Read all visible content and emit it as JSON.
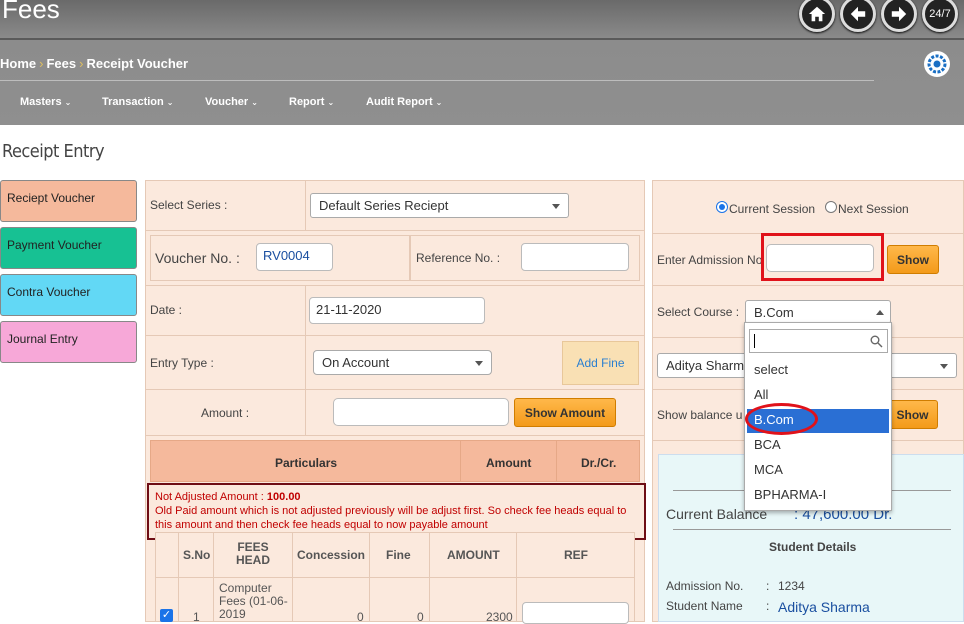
{
  "header": {
    "title": "Fees",
    "icons": [
      "home-icon",
      "arrow-left-icon",
      "arrow-right-icon",
      "support-24-7-icon"
    ],
    "support_label": "24/7",
    "breadcrumb": [
      "Home",
      "Fees",
      "Receipt Voucher"
    ]
  },
  "menu": [
    "Masters",
    "Transaction",
    "Voucher",
    "Report",
    "Audit Report"
  ],
  "page_title": "Receipt Entry",
  "nav": [
    {
      "label": "Reciept Voucher",
      "color": "#f5b99c"
    },
    {
      "label": "Payment Voucher",
      "color": "#17c193"
    },
    {
      "label": "Contra Voucher",
      "color": "#62d8f5"
    },
    {
      "label": "Journal Entry",
      "color": "#f7a8d8"
    }
  ],
  "form": {
    "select_series_label": "Select Series :",
    "select_series_value": "Default Series Reciept",
    "voucher_no_label": "Voucher No. :",
    "voucher_no_value": "RV0004",
    "reference_no_label": "Reference No. :",
    "reference_no_value": "",
    "date_label": "Date :",
    "date_value": "21-11-2020",
    "entry_type_label": "Entry Type :",
    "entry_type_value": "On Account",
    "add_fine_label": "Add Fine",
    "amount_label": "Amount :",
    "amount_value": "",
    "show_amount_label": "Show Amount"
  },
  "table": {
    "header": [
      "Particulars",
      "Amount",
      "Dr./Cr."
    ],
    "notice_title": "Not Adjusted Amount : ",
    "notice_amount": "100.00",
    "notice_text": "Old Paid amount which is not adjusted previously will be adjust first. So check fee heads equal to this amount and then check fee heads equal to now payable amount",
    "columns": [
      "S.No",
      "FEES HEAD",
      "Concession",
      "Fine",
      "AMOUNT",
      "REF"
    ],
    "rows": [
      {
        "checked": true,
        "sno": "1",
        "head": "Computer Fees (01-06-2019",
        "concession": "0",
        "fine": "0",
        "amount": "2300",
        "ref": ""
      }
    ]
  },
  "right": {
    "current_session_label": "Current Session",
    "next_session_label": "Next Session",
    "admission_label": "Enter Admission No",
    "admission_value": "",
    "show_label": "Show",
    "select_course_label": "Select Course :",
    "select_course_value": "B.Com",
    "student_select_value": "Aditya Sharm",
    "show_balance_label": "Show balance u",
    "show2_label": "Show",
    "current_balance_label": "Current Balance",
    "current_balance_value": ": 47,600.00 Dr.",
    "student_details_label": "Student Details",
    "admission_no_label": "Admission No.",
    "admission_no_value": "1234",
    "student_name_label": "Student Name",
    "student_name_value": "Aditya Sharma"
  },
  "dropdown": {
    "search_value": "",
    "options": [
      "select",
      "All",
      "B.Com",
      "BCA",
      "MCA",
      "BPHARMA-I"
    ],
    "selected": "B.Com"
  }
}
